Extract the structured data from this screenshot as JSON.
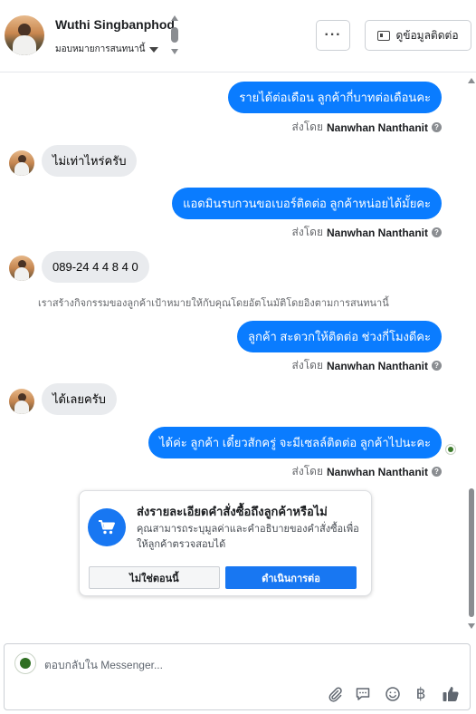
{
  "header": {
    "contact_name": "Wuthi Singbanphod",
    "assign_label": "มอบหมายการสนทนานี้",
    "more_label": "···",
    "view_contact_label": "ดูข้อมูลติดต่อ"
  },
  "messages": [
    {
      "direction": "out",
      "text": "รายได้ต่อเดือน ลูกค้ากี่บาทต่อเดือนคะ",
      "sent_by_prefix": "ส่งโดย",
      "sent_by_name": "Nanwhan Nanthanit"
    },
    {
      "direction": "in",
      "text": "ไม่เท่าไหร่ครับ"
    },
    {
      "direction": "out",
      "text": "แอดมินรบกวนขอเบอร์ติดต่อ ลูกค้าหน่อยได้มั้ยคะ",
      "sent_by_prefix": "ส่งโดย",
      "sent_by_name": "Nanwhan Nanthanit"
    },
    {
      "direction": "in",
      "text": "089-24 4 4 8 4 0"
    },
    {
      "direction": "system",
      "text": "เราสร้างกิจกรรมของลูกค้าเป้าหมายให้กับคุณโดยอัตโนมัติโดยอิงตามการสนทนานี้"
    },
    {
      "direction": "out",
      "text": "ลูกค้า สะดวกให้ติดต่อ ช่วงกี่โมงดีคะ",
      "sent_by_prefix": "ส่งโดย",
      "sent_by_name": "Nanwhan Nanthanit"
    },
    {
      "direction": "in",
      "text": "ได้เลยครับ"
    },
    {
      "direction": "out",
      "text": "ได้ค่ะ  ลูกค้า เดี๋ยวสักครู่ จะมีเซลล์ติดต่อ ลูกค้าไปนะคะ",
      "sent_by_prefix": "ส่งโดย",
      "sent_by_name": "Nanwhan Nanthanit"
    }
  ],
  "order_prompt": {
    "title": "ส่งรายละเอียดคำสั่งซื้อถึงลูกค้าหรือไม่",
    "description": "คุณสามารถระบุมูลค่าและคำอธิบายของคำสั่งซื้อเพื่อให้ลูกค้าตรวจสอบได้",
    "decline_label": "ไม่ใช่ตอนนี้",
    "accept_label": "ดำเนินการต่อ"
  },
  "composer": {
    "placeholder": "ตอบกลับใน Messenger...",
    "currency_symbol": "฿"
  },
  "colors": {
    "outgoing_bubble": "#0a7cff",
    "incoming_bubble": "#e9ebee",
    "primary_button": "#1877f2"
  }
}
